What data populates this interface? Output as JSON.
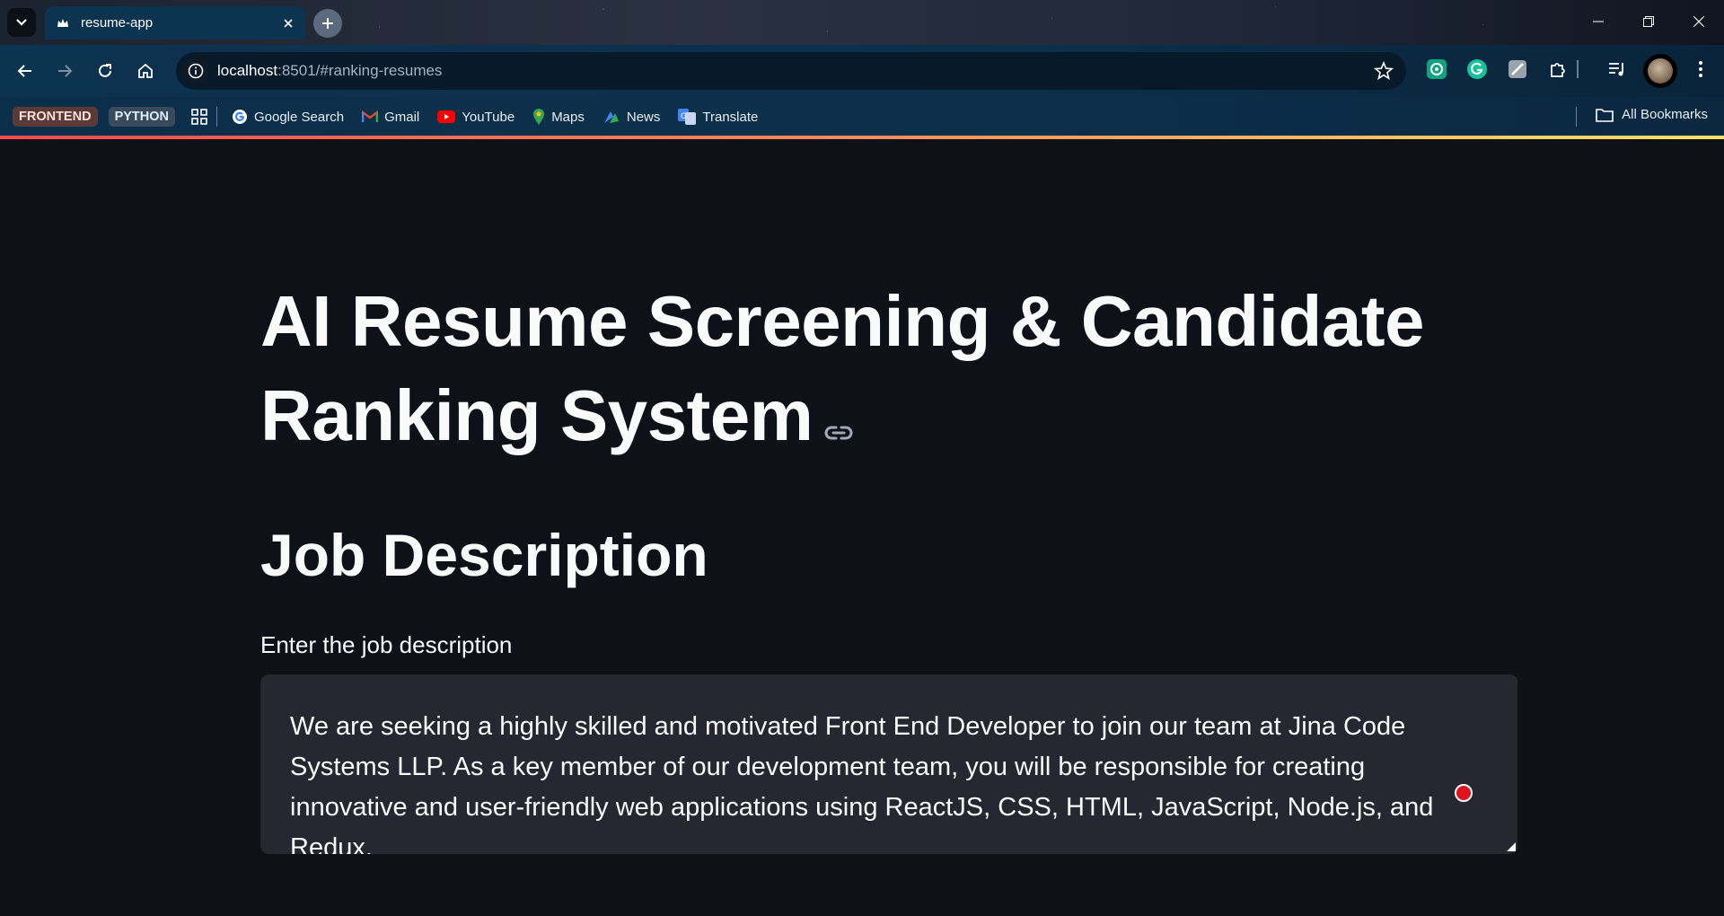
{
  "browser": {
    "tab_title": "resume-app",
    "url_host": "localhost",
    "url_rest": ":8501/#ranking-resumes"
  },
  "bookmarks": {
    "chips": [
      "FRONTEND",
      "PYTHON"
    ],
    "items": [
      "Google Search",
      "Gmail",
      "YouTube",
      "Maps",
      "News",
      "Translate"
    ],
    "all_bookmarks": "All Bookmarks"
  },
  "page": {
    "title": "AI Resume Screening & Candidate Ranking System",
    "section_title": "Job Description",
    "field_label": "Enter the job description",
    "job_description": "We are seeking a highly skilled and motivated Front End Developer to join our team at Jina Code Systems LLP. As a key member of our development team, you will be responsible for creating innovative and user-friendly web applications using ReactJS, CSS, HTML, JavaScript, Node.js, and Redux."
  },
  "colors": {
    "app_background": "#0e1117",
    "textarea_background": "#262730",
    "header_gradient_start": "#ff4b4b",
    "header_gradient_end": "#ffe16a"
  }
}
